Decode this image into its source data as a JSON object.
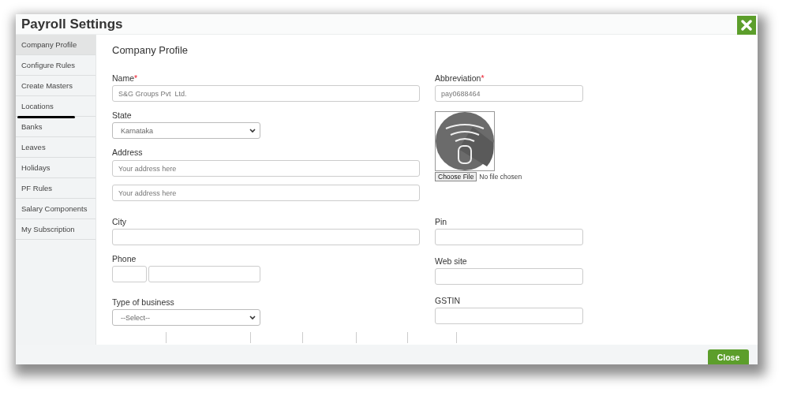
{
  "window": {
    "title": "Payroll Settings"
  },
  "sidebar": {
    "items": [
      {
        "label": "Company Profile",
        "selected": true,
        "marked": false
      },
      {
        "label": "Configure Rules",
        "selected": false,
        "marked": false
      },
      {
        "label": "Create Masters",
        "selected": false,
        "marked": false
      },
      {
        "label": "Locations",
        "selected": false,
        "marked": true
      },
      {
        "label": "Banks",
        "selected": false,
        "marked": false
      },
      {
        "label": "Leaves",
        "selected": false,
        "marked": false
      },
      {
        "label": "Holidays",
        "selected": false,
        "marked": false
      },
      {
        "label": "PF Rules",
        "selected": false,
        "marked": false
      },
      {
        "label": "Salary Components",
        "selected": false,
        "marked": false
      },
      {
        "label": "My Subscription",
        "selected": false,
        "marked": false
      }
    ]
  },
  "form": {
    "heading": "Company Profile",
    "left": [
      {
        "kind": "text",
        "label": "Name",
        "required_mark": "*",
        "value": "S&G Groups Pvt  Ltd."
      },
      {
        "kind": "select",
        "label": "State",
        "value": "Karnataka"
      },
      {
        "kind": "stack",
        "label": "Address",
        "inputs": [
          {
            "placeholder": "Your address here"
          },
          {
            "placeholder": "Your address here"
          }
        ]
      },
      {
        "kind": "text",
        "label": "City"
      },
      {
        "kind": "pair",
        "label": "Phone"
      },
      {
        "kind": "select",
        "label": "Type of business",
        "value": "--Select--"
      }
    ],
    "right": [
      {
        "kind": "text",
        "label": "Abbreviation",
        "required_mark": "*",
        "value": "pay0688464"
      },
      {
        "kind": "image",
        "button": "Choose File",
        "status": "No file chosen"
      },
      {
        "kind": "text",
        "label": "Pin"
      },
      {
        "kind": "text",
        "label": "Web site"
      },
      {
        "kind": "text",
        "label": "GSTIN"
      }
    ]
  },
  "footer": {
    "button": "Close"
  }
}
